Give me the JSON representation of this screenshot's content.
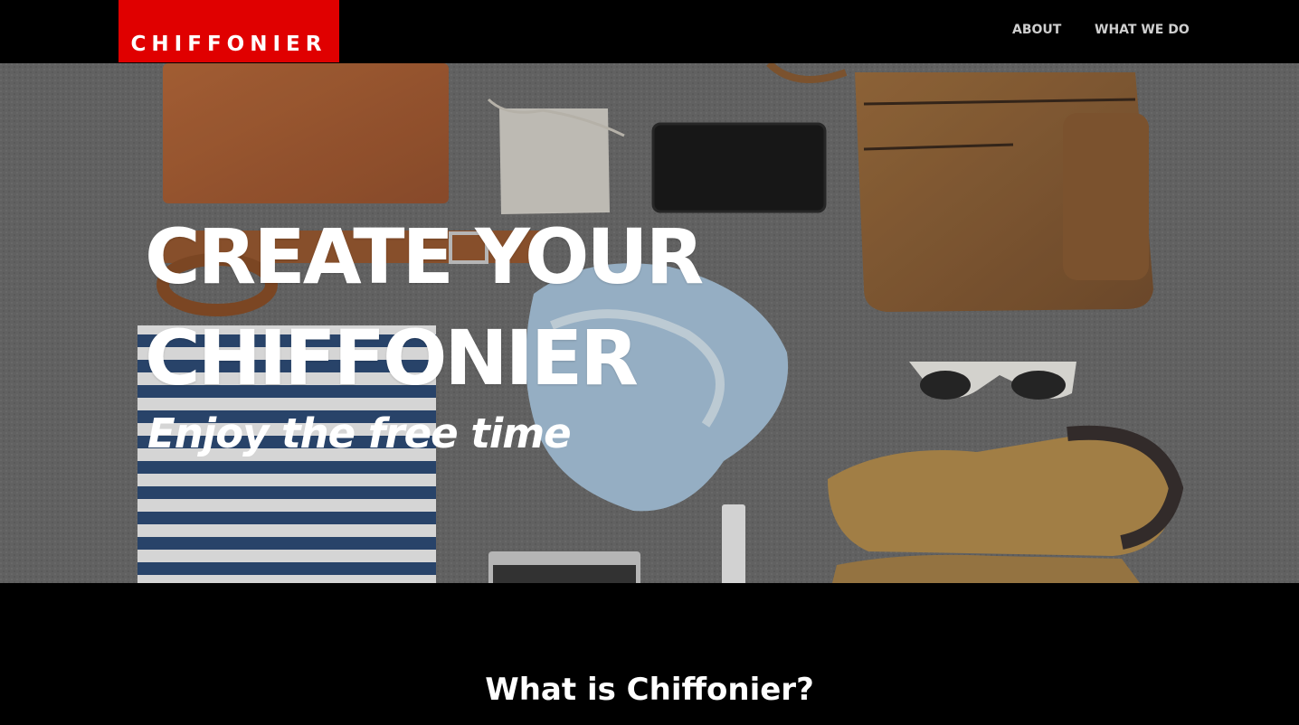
{
  "brand": {
    "name": "CHIFFONIER",
    "color": "#e00000"
  },
  "nav": {
    "items": [
      {
        "label": "ABOUT"
      },
      {
        "label": "WHAT WE DO"
      }
    ]
  },
  "hero": {
    "title": "CREATE YOUR CHIFFONIER",
    "subtitle": "Enjoy the free time",
    "background_image": "flat-lay-of-travel-items-on-grey-carpet"
  },
  "section": {
    "title": "What is Chiffonier?"
  }
}
